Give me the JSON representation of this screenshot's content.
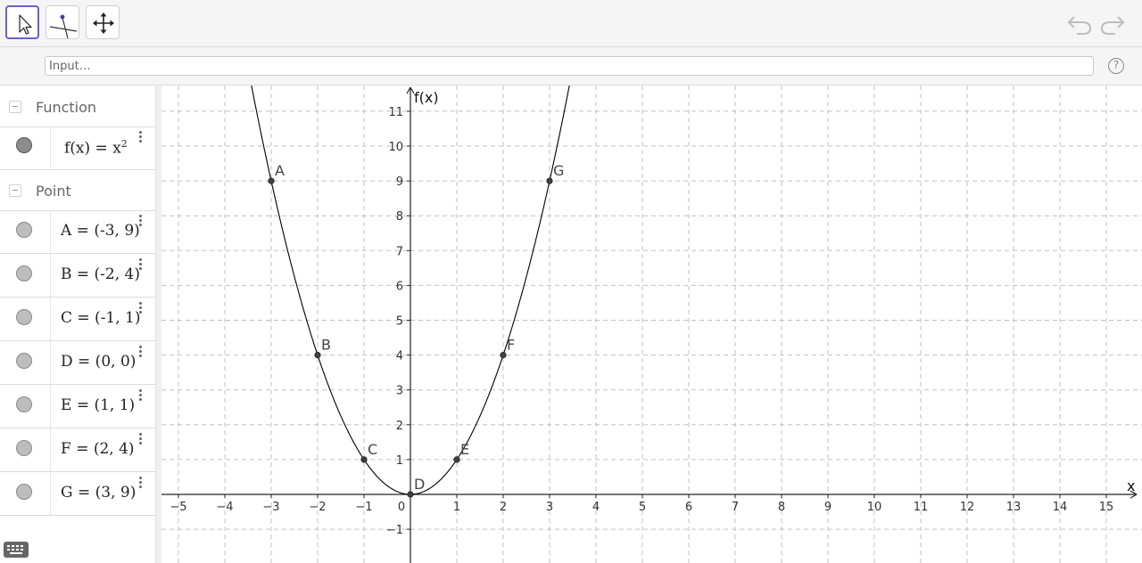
{
  "toolbar": {
    "tools": [
      {
        "name": "move-tool",
        "icon": "arrow-cursor-icon",
        "active": true
      },
      {
        "name": "point-tool",
        "icon": "point-on-object-icon",
        "active": false
      },
      {
        "name": "move-graphics-view-tool",
        "icon": "four-way-arrows-icon",
        "active": false
      }
    ],
    "undo_icon": "undo-icon",
    "redo_icon": "redo-icon"
  },
  "input_bar": {
    "placeholder": "Input…",
    "help_label": "?"
  },
  "algebra": {
    "groups": [
      {
        "label": "Function",
        "items": [
          {
            "lhs": "f(x) = x",
            "sup": "2"
          }
        ]
      },
      {
        "label": "Point",
        "items": [
          {
            "text": "A = (-3, 9)"
          },
          {
            "text": "B = (-2, 4)"
          },
          {
            "text": "C = (-1, 1)"
          },
          {
            "text": "D = (0, 0)"
          },
          {
            "text": "E = (1, 1)"
          },
          {
            "text": "F = (2, 4)"
          },
          {
            "text": "G = (3, 9)"
          }
        ]
      }
    ]
  },
  "chart_data": {
    "type": "line",
    "xlabel": "x",
    "ylabel": "f(x)",
    "xlim": [
      -5.5,
      15.7
    ],
    "ylim": [
      -1.9,
      11.9
    ],
    "x_ticks": [
      -5,
      -4,
      -3,
      -2,
      -1,
      0,
      1,
      2,
      3,
      4,
      5,
      6,
      7,
      8,
      9,
      10,
      11,
      12,
      13,
      14,
      15
    ],
    "x_tick_labels": [
      "−5",
      "−4",
      "−3",
      "−2",
      "−1",
      "0",
      "1",
      "2",
      "3",
      "4",
      "5",
      "6",
      "7",
      "8",
      "9",
      "10",
      "11",
      "12",
      "13",
      "14",
      "15"
    ],
    "y_ticks": [
      -1,
      1,
      2,
      3,
      4,
      5,
      6,
      7,
      8,
      9,
      10,
      11
    ],
    "y_tick_labels": [
      "−1",
      "1",
      "2",
      "3",
      "4",
      "5",
      "6",
      "7",
      "8",
      "9",
      "10",
      "11"
    ],
    "grid": true,
    "function": {
      "expression": "x^2",
      "color": "#000000"
    },
    "points": [
      {
        "label": "A",
        "x": -3,
        "y": 9
      },
      {
        "label": "B",
        "x": -2,
        "y": 4
      },
      {
        "label": "C",
        "x": -1,
        "y": 1
      },
      {
        "label": "D",
        "x": 0,
        "y": 0
      },
      {
        "label": "E",
        "x": 1,
        "y": 1
      },
      {
        "label": "F",
        "x": 2,
        "y": 4
      },
      {
        "label": "G",
        "x": 3,
        "y": 9
      }
    ]
  },
  "colors": {
    "accent": "#6a5fd8",
    "grid": "#c0c0c0",
    "point": "#404040"
  }
}
